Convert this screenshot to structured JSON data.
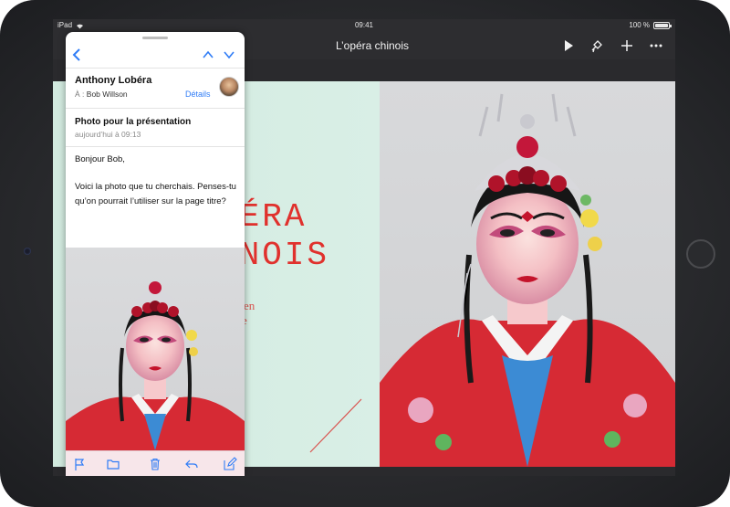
{
  "status_bar": {
    "carrier": "iPad",
    "time": "09:41",
    "battery": "100 %",
    "battery_level": 1.0
  },
  "toolbar": {
    "document_title": "L’opéra chinois",
    "icons": [
      "play-icon",
      "paintbrush-icon",
      "plus-icon",
      "more-icon"
    ]
  },
  "document": {
    "title_line_1": "PÉRA",
    "title_line_2": "INOIS",
    "subtitle_line_1": "en",
    "subtitle_line_2": "e",
    "colors": {
      "title": "#e0312d",
      "page_background": "#d6ece2"
    }
  },
  "mail": {
    "nav_icons": [
      "back-chevron-icon",
      "previous-message-icon",
      "next-message-icon"
    ],
    "sender": "Anthony Lobéra",
    "to_label": "À :",
    "recipient": "Bob Willson",
    "details": "Détails",
    "subject": "Photo pour la présentation",
    "date": "aujourd’hui à 09:13",
    "body": {
      "greeting": "Bonjour Bob,",
      "paragraph": "Voici la photo que tu cherchais. Penses-tu qu’on pourrait l’utiliser sur la page titre?"
    },
    "toolbar_icons": [
      "flag-icon",
      "folder-icon",
      "trash-icon",
      "reply-icon",
      "compose-icon"
    ],
    "accent_color": "#2f7cf6"
  }
}
